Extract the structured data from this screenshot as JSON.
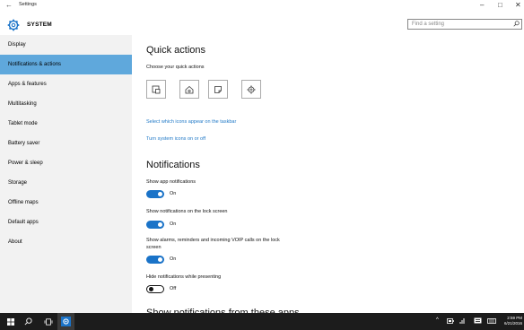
{
  "window": {
    "title": "Settings",
    "back_glyph": "←",
    "minimize_glyph": "–",
    "maximize_glyph": "□",
    "close_glyph": "✕"
  },
  "header": {
    "section_title": "SYSTEM",
    "icon": "gear-icon"
  },
  "search": {
    "placeholder": "Find a setting",
    "icon": "search-icon"
  },
  "sidebar": {
    "items": [
      {
        "label": "Display",
        "active": false
      },
      {
        "label": "Notifications & actions",
        "active": true
      },
      {
        "label": "Apps & features",
        "active": false
      },
      {
        "label": "Multitasking",
        "active": false
      },
      {
        "label": "Tablet mode",
        "active": false
      },
      {
        "label": "Battery saver",
        "active": false
      },
      {
        "label": "Power & sleep",
        "active": false
      },
      {
        "label": "Storage",
        "active": false
      },
      {
        "label": "Offline maps",
        "active": false
      },
      {
        "label": "Default apps",
        "active": false
      },
      {
        "label": "About",
        "active": false
      }
    ],
    "active_color": "#5fa8dc"
  },
  "main": {
    "quick_actions_heading": "Quick actions",
    "quick_actions_sub": "Choose your quick actions",
    "quick_action_icons": [
      "tablet-mode-icon",
      "settings-home-icon",
      "note-icon",
      "settings-gear-icon"
    ],
    "link_taskbar_icons": "Select which icons appear on the taskbar",
    "link_system_icons": "Turn system icons on or off",
    "notifications_heading": "Notifications",
    "settings": [
      {
        "label": "Show app notifications",
        "state": "On"
      },
      {
        "label": "Show notifications on the lock screen",
        "state": "On"
      },
      {
        "label_line1": "Show alarms, reminders and incoming VOIP calls on the lock",
        "label_line2": "screen",
        "state": "On"
      },
      {
        "label": "Hide notifications while presenting",
        "state": "Off"
      }
    ],
    "truncated_heading": "Show notifications from these apps",
    "link_color": "#2079c7",
    "toggle_on_color": "#1a73c8"
  },
  "taskbar": {
    "icons": [
      "windows-start-icon",
      "search-icon",
      "task-view-icon",
      "settings-icon"
    ],
    "tray_icons": [
      "chevron-up-icon",
      "battery-icon",
      "network-icon",
      "notification-icon",
      "keyboard-icon"
    ],
    "time": "2:59 PM",
    "date": "6/21/2016"
  }
}
